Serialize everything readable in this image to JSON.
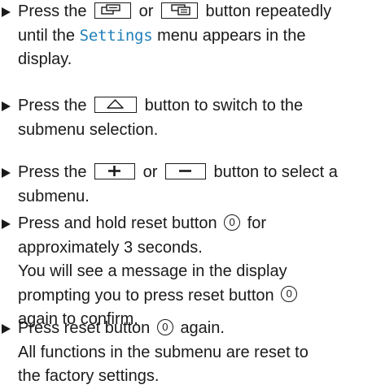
{
  "steps": [
    {
      "line1_a": "Press the",
      "line1_b": "or",
      "line1_c": "button repeatedly",
      "line2_a": "until the",
      "menu_name": "Settings",
      "line2_b": "menu appears in the",
      "line3": "display."
    },
    {
      "line1_a": "Press the",
      "line1_b": "button to switch to the",
      "line2": "submenu selection."
    },
    {
      "line1_a": "Press the",
      "line1_b": "or",
      "line1_c": "button to select a",
      "line2": "submenu."
    },
    {
      "line1_a": "Press and hold reset button",
      "line1_b": "for",
      "line2": "approximately 3 seconds.",
      "line3": "You will see a message in the display",
      "line4_a": "prompting you to press reset button",
      "line5": "again to confirm."
    },
    {
      "line1_a": "Press reset button",
      "line1_b": "again.",
      "line2": "All functions in the submenu are reset to",
      "line3": "the factory settings."
    }
  ],
  "reset_button_symbol": "0",
  "highlight_color": "#1f7fb8",
  "icons": {
    "display_left": "display-left-icon",
    "display_right": "display-right-icon",
    "back_up": "back-up-icon",
    "plus": "plus-icon",
    "minus": "minus-icon",
    "reset": "reset-button-icon"
  }
}
